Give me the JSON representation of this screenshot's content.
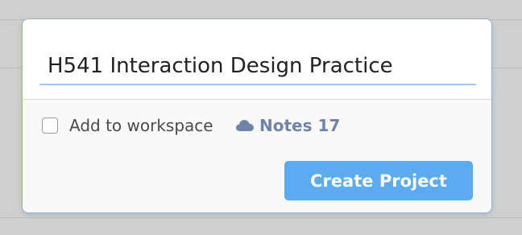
{
  "project_form": {
    "name_value": "H541 Interaction Design Practice",
    "add_to_workspace_label": "Add to workspace",
    "add_to_workspace_checked": false,
    "workspace_icon": "cloud-icon",
    "workspace_name": "Notes 17",
    "create_button_label": "Create Project"
  },
  "colors": {
    "accent": "#5aabf1",
    "workspace_link": "#6e84a8",
    "focus_border": "#8bb4e4"
  }
}
